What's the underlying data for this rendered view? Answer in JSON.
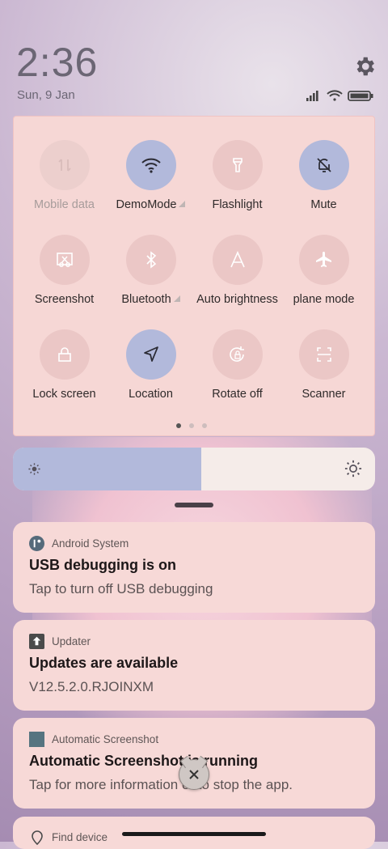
{
  "status": {
    "time": "2:36",
    "date": "Sun, 9 Jan"
  },
  "tiles": [
    {
      "label": "Mobile data",
      "state": "off",
      "icon": "mobile-data-icon"
    },
    {
      "label": "DemoMode",
      "state": "on",
      "icon": "wifi-icon"
    },
    {
      "label": "Flashlight",
      "state": "off",
      "icon": "flashlight-icon"
    },
    {
      "label": "Mute",
      "state": "on",
      "icon": "bell-off-icon"
    },
    {
      "label": "Screenshot",
      "state": "off",
      "icon": "screenshot-icon"
    },
    {
      "label": "Bluetooth",
      "state": "off",
      "icon": "bluetooth-icon"
    },
    {
      "label": "Auto brightness",
      "state": "off",
      "icon": "auto-brightness-icon"
    },
    {
      "label": "Airplane mode",
      "visible_label": "plane mode",
      "state": "off",
      "icon": "airplane-icon"
    },
    {
      "label": "Lock screen",
      "state": "off",
      "icon": "lock-icon"
    },
    {
      "label": "Location",
      "state": "on",
      "icon": "location-icon"
    },
    {
      "label": "Rotate off",
      "state": "off",
      "icon": "rotate-lock-icon"
    },
    {
      "label": "Scanner",
      "state": "off",
      "icon": "scanner-icon"
    }
  ],
  "brightness": {
    "level": 0.52
  },
  "notifications": [
    {
      "app": "Android System",
      "title": "USB debugging is on",
      "body": "Tap to turn off USB debugging"
    },
    {
      "app": "Updater",
      "title": "Updates are available",
      "body": "V12.5.2.0.RJOINXM"
    },
    {
      "app": "Automatic Screenshot",
      "title": "Automatic Screenshot is running",
      "body": "Tap for more information or to stop the app."
    },
    {
      "app": "Find device"
    }
  ],
  "colors": {
    "tile_on": "#b2b9db",
    "tile_off": "#ebc7c6",
    "panel": "#f6d7d5"
  }
}
